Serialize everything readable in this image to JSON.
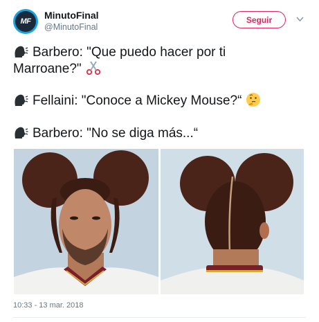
{
  "tweet": {
    "author_name": "MinutoFinal",
    "author_handle": "@MinutoFinal",
    "avatar_text": "MF",
    "follow_label": "Seguir",
    "lines": [
      "Barbero: \"Que puedo hacer por ti",
      "Marroane?\"",
      "Fellaini: \"Conoce a Mickey Mouse?“",
      "Barbero: \"No se diga más...“"
    ],
    "timestamp": "10:33 - 13 mar. 2018"
  },
  "icons": {
    "speaking_head": "speaking-head-icon",
    "scissors": "scissors-icon",
    "thinking_face": "thinking-face-icon",
    "dropdown": "chevron-down-icon"
  },
  "colors": {
    "accent": "#e0245e",
    "text": "#14171a",
    "secondary": "#657786",
    "avatar_bg": "#17a2e0"
  }
}
